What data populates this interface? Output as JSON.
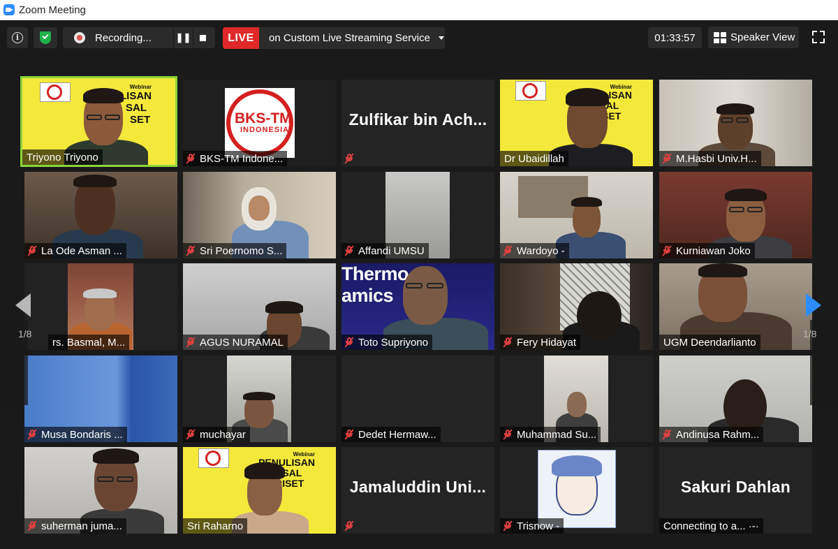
{
  "window": {
    "title": "Zoom Meeting"
  },
  "toolbar": {
    "info_icon": "i",
    "recording_label": "Recording...",
    "pause_icon": "❚❚",
    "live_label": "LIVE",
    "live_service": "on Custom Live Streaming Service",
    "timer": "01:33:57",
    "view_label": "Speaker View"
  },
  "gallery": {
    "page_left": "1/8",
    "page_right": "1/8",
    "tiles": [
      {
        "name": "Triyono Triyono",
        "muted": false,
        "active": true
      },
      {
        "name": "BKS-TM Indone...",
        "muted": true
      },
      {
        "name": "",
        "display_name": "Zulfikar bin Ach...",
        "muted": true
      },
      {
        "name": "Dr Ubaidillah",
        "muted": false
      },
      {
        "name": "M.Hasbi Univ.H...",
        "muted": true
      },
      {
        "name": "La Ode Asman ...",
        "muted": true
      },
      {
        "name": "Sri Poernomo S...",
        "muted": true
      },
      {
        "name": "Affandi UMSU",
        "muted": true
      },
      {
        "name": "Wardoyo -",
        "muted": true
      },
      {
        "name": "Kurniawan Joko",
        "muted": true
      },
      {
        "name": "rs. Basmal,  M...",
        "muted": false
      },
      {
        "name": "AGUS NURAMAL",
        "muted": true
      },
      {
        "name": "Toto Supriyono",
        "muted": true,
        "slide_title": "Thermo",
        "slide_title_2": "amics"
      },
      {
        "name": "Fery Hidayat",
        "muted": true
      },
      {
        "name": "UGM Deendarlianto",
        "muted": false
      },
      {
        "name": "Musa Bondaris ...",
        "muted": true
      },
      {
        "name": "muchayar",
        "muted": true
      },
      {
        "name": "Dedet Hermaw...",
        "muted": true
      },
      {
        "name": "Muhammad Su...",
        "muted": true
      },
      {
        "name": "Andinusa Rahm...",
        "muted": true
      },
      {
        "name": "suherman juma...",
        "muted": true
      },
      {
        "name": "Sri Raharno",
        "muted": false
      },
      {
        "name": "",
        "display_name": "Jamaluddin  Uni...",
        "muted": true
      },
      {
        "name": "Trisnow -",
        "muted": true
      },
      {
        "name": "Connecting to a... ·-·",
        "display_name": "Sakuri Dahlan",
        "muted": false
      }
    ]
  },
  "logos": {
    "bks_text": "BKS-TM",
    "bks_sub": "INDONESIA",
    "webinar_small": "Webinar",
    "webinar_l1": "LISAN",
    "webinar_l2": "SAL",
    "webinar_l3": "SET",
    "webinar_b1": "PENULISAN",
    "webinar_b2": "POSAL",
    "webinar_b3": "RISET"
  },
  "colors": {
    "accent_live": "#e02828",
    "active_speaker": "#8bd43b",
    "muted_mic": "#e04040",
    "nav_next": "#2d8cff"
  }
}
